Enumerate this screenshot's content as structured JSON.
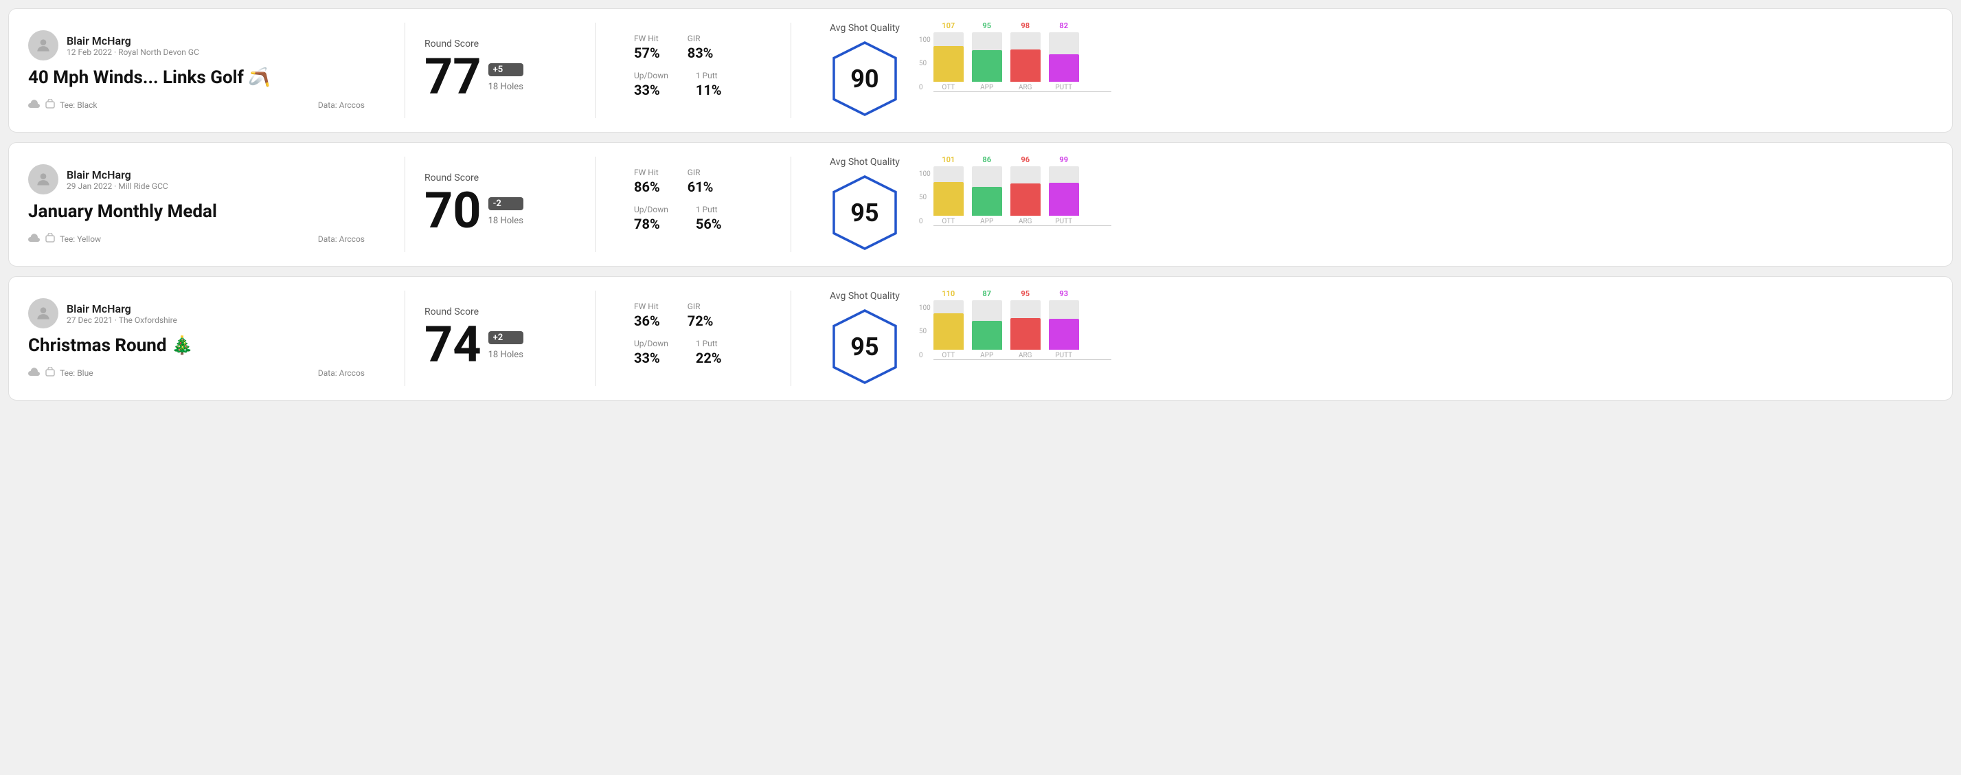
{
  "rounds": [
    {
      "id": "round1",
      "user": {
        "name": "Blair McHarg",
        "date_course": "12 Feb 2022 · Royal North Devon GC"
      },
      "title": "40 Mph Winds... Links Golf 🪃",
      "tee": "Black",
      "data_source": "Data: Arccos",
      "round_score_label": "Round Score",
      "score": "77",
      "score_badge": "+5",
      "holes": "18 Holes",
      "stats": {
        "fw_hit_label": "FW Hit",
        "fw_hit_value": "57%",
        "gir_label": "GIR",
        "gir_value": "83%",
        "updown_label": "Up/Down",
        "updown_value": "33%",
        "oneputt_label": "1 Putt",
        "oneputt_value": "11%"
      },
      "avg_shot_quality_label": "Avg Shot Quality",
      "quality_score": "90",
      "chart": {
        "ott": {
          "value": 107,
          "color": "#e8c840",
          "pct": 0.71
        },
        "app": {
          "value": 95,
          "color": "#4ac476",
          "pct": 0.63
        },
        "arg": {
          "value": 98,
          "color": "#e85050",
          "pct": 0.65
        },
        "putt": {
          "value": 82,
          "color": "#d040e8",
          "pct": 0.55
        }
      },
      "y_labels": [
        "100",
        "50",
        "0"
      ]
    },
    {
      "id": "round2",
      "user": {
        "name": "Blair McHarg",
        "date_course": "29 Jan 2022 · Mill Ride GCC"
      },
      "title": "January Monthly Medal",
      "tee": "Yellow",
      "data_source": "Data: Arccos",
      "round_score_label": "Round Score",
      "score": "70",
      "score_badge": "-2",
      "holes": "18 Holes",
      "stats": {
        "fw_hit_label": "FW Hit",
        "fw_hit_value": "86%",
        "gir_label": "GIR",
        "gir_value": "61%",
        "updown_label": "Up/Down",
        "updown_value": "78%",
        "oneputt_label": "1 Putt",
        "oneputt_value": "56%"
      },
      "avg_shot_quality_label": "Avg Shot Quality",
      "quality_score": "95",
      "chart": {
        "ott": {
          "value": 101,
          "color": "#e8c840",
          "pct": 0.67
        },
        "app": {
          "value": 86,
          "color": "#4ac476",
          "pct": 0.57
        },
        "arg": {
          "value": 96,
          "color": "#e85050",
          "pct": 0.64
        },
        "putt": {
          "value": 99,
          "color": "#d040e8",
          "pct": 0.66
        }
      },
      "y_labels": [
        "100",
        "50",
        "0"
      ]
    },
    {
      "id": "round3",
      "user": {
        "name": "Blair McHarg",
        "date_course": "27 Dec 2021 · The Oxfordshire"
      },
      "title": "Christmas Round 🎄",
      "tee": "Blue",
      "data_source": "Data: Arccos",
      "round_score_label": "Round Score",
      "score": "74",
      "score_badge": "+2",
      "holes": "18 Holes",
      "stats": {
        "fw_hit_label": "FW Hit",
        "fw_hit_value": "36%",
        "gir_label": "GIR",
        "gir_value": "72%",
        "updown_label": "Up/Down",
        "updown_value": "33%",
        "oneputt_label": "1 Putt",
        "oneputt_value": "22%"
      },
      "avg_shot_quality_label": "Avg Shot Quality",
      "quality_score": "95",
      "chart": {
        "ott": {
          "value": 110,
          "color": "#e8c840",
          "pct": 0.73
        },
        "app": {
          "value": 87,
          "color": "#4ac476",
          "pct": 0.58
        },
        "arg": {
          "value": 95,
          "color": "#e85050",
          "pct": 0.63
        },
        "putt": {
          "value": 93,
          "color": "#d040e8",
          "pct": 0.62
        }
      },
      "y_labels": [
        "100",
        "50",
        "0"
      ]
    }
  ],
  "chart_x_labels": [
    "OTT",
    "APP",
    "ARG",
    "PUTT"
  ]
}
